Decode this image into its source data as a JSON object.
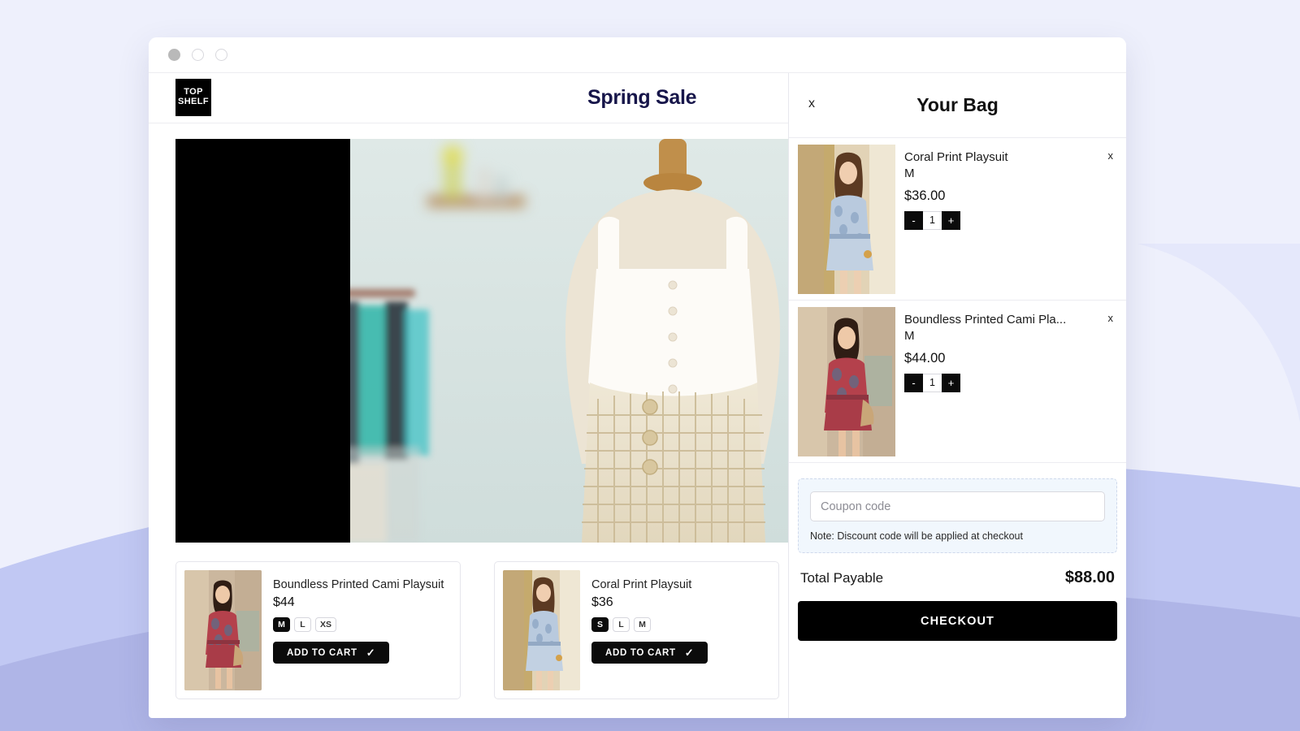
{
  "background": {
    "base_color": "#eef0fc",
    "accent_color": "#b6bef0"
  },
  "window": {
    "dots": [
      "filled",
      "hollow",
      "hollow"
    ]
  },
  "store_header": {
    "logo_line1": "TOP",
    "logo_line2": "SHELF",
    "title": "Spring Sale",
    "title_color": "#17164a"
  },
  "hero": {
    "alt": "boutique-store-owner-with-mannequin",
    "black_panel_label": ""
  },
  "products": [
    {
      "name": "Boundless Printed Cami Playsuit",
      "price": "$44",
      "sizes": [
        {
          "label": "M",
          "selected": true
        },
        {
          "label": "L",
          "selected": false
        },
        {
          "label": "XS",
          "selected": false
        }
      ],
      "add_label": "ADD TO CART",
      "check_icon": "✓",
      "thumb": "red-floral-playsuit-model"
    },
    {
      "name": "Coral Print Playsuit",
      "price": "$36",
      "sizes": [
        {
          "label": "S",
          "selected": true
        },
        {
          "label": "L",
          "selected": false
        },
        {
          "label": "M",
          "selected": false
        }
      ],
      "add_label": "ADD TO CART",
      "check_icon": "✓",
      "thumb": "blue-floral-playsuit-model"
    }
  ],
  "cart": {
    "close_label": "x",
    "title": "Your Bag",
    "items": [
      {
        "name": "Coral Print Playsuit",
        "size": "M",
        "price": "$36.00",
        "qty": "1",
        "minus": "-",
        "plus": "+",
        "remove_label": "x",
        "thumb": "blue-floral-playsuit-model"
      },
      {
        "name": "Boundless Printed Cami Pla...",
        "size": "M",
        "price": "$44.00",
        "qty": "1",
        "minus": "-",
        "plus": "+",
        "remove_label": "x",
        "thumb": "red-floral-playsuit-model"
      }
    ],
    "coupon": {
      "placeholder": "Coupon code",
      "value": "",
      "note": "Note: Discount code will be applied at checkout"
    },
    "total_label": "Total Payable",
    "total_value": "$88.00",
    "checkout_label": "CHECKOUT"
  }
}
